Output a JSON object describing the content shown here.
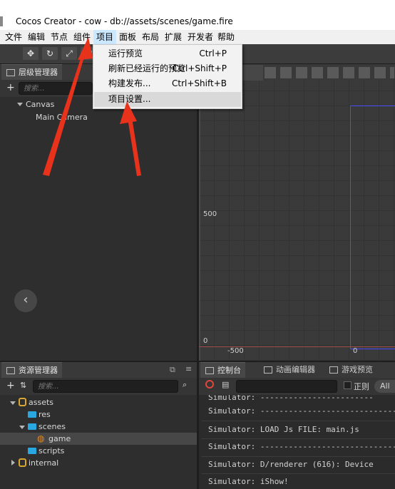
{
  "window": {
    "title": "Cocos Creator - cow - db://assets/scenes/game.fire"
  },
  "menubar": {
    "items": [
      {
        "label": "文件"
      },
      {
        "label": "编辑"
      },
      {
        "label": "节点"
      },
      {
        "label": "组件"
      },
      {
        "label": "项目"
      },
      {
        "label": "面板"
      },
      {
        "label": "布局"
      },
      {
        "label": "扩展"
      },
      {
        "label": "开发者"
      },
      {
        "label": "帮助"
      }
    ]
  },
  "project_menu": {
    "items": [
      {
        "label": "运行预览",
        "shortcut": "Ctrl+P"
      },
      {
        "label": "刷新已经运行的预览",
        "shortcut": "Ctrl+Shift+P"
      },
      {
        "label": "构建发布...",
        "shortcut": "Ctrl+Shift+B"
      },
      {
        "label": "项目设置..."
      }
    ]
  },
  "hierarchy": {
    "tab": "层级管理器",
    "search_placeholder": "搜索...",
    "nodes": [
      {
        "label": "Canvas"
      },
      {
        "label": "Main Camera"
      }
    ],
    "collapse_glyph": "‹"
  },
  "scene": {
    "ruler": {
      "y_500": "500",
      "y_0": "0",
      "x_neg500": "-500",
      "x_0": "0"
    }
  },
  "assets": {
    "tab": "资源管理器",
    "search_placeholder": "搜索...",
    "tree": [
      {
        "label": "assets"
      },
      {
        "label": "res"
      },
      {
        "label": "scenes"
      },
      {
        "label": "game"
      },
      {
        "label": "scripts"
      },
      {
        "label": "internal"
      }
    ]
  },
  "console": {
    "tabs": [
      {
        "label": "控制台"
      },
      {
        "label": "动画编辑器"
      },
      {
        "label": "游戏预览"
      }
    ],
    "regex_label": "正则",
    "level": "All",
    "lines": [
      "Simulator: ------------------------------",
      "Simulator: LOAD Js FILE: main.js",
      "Simulator: ------------------------------",
      "Simulator: D/renderer (616): Device",
      "Simulator: iShow!"
    ]
  },
  "annotations": {
    "arrow_color": "#e8321c"
  },
  "colors": {
    "scene_frame": "#4a4aff",
    "highlight": "#cce8ff"
  }
}
